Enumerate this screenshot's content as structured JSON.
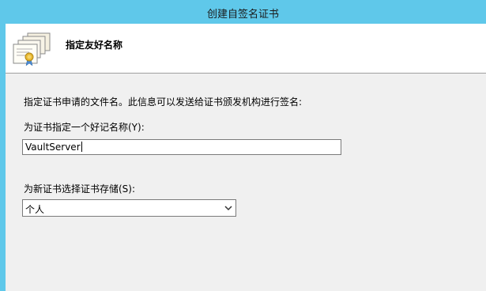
{
  "window": {
    "title": "创建自签名证书"
  },
  "header": {
    "icon": "certificate-icon",
    "title": "指定友好名称"
  },
  "content": {
    "description": "指定证书申请的文件名。此信息可以发送给证书颁发机构进行签名:",
    "friendly_name_label": "为证书指定一个好记名称(Y):",
    "friendly_name_value": "VaultServer",
    "store_label": "为新证书选择证书存储(S):",
    "store_selected": "个人"
  },
  "colors": {
    "titlebar": "#5fc8ea",
    "background": "#f0f0f0",
    "header_background": "#ffffff"
  }
}
